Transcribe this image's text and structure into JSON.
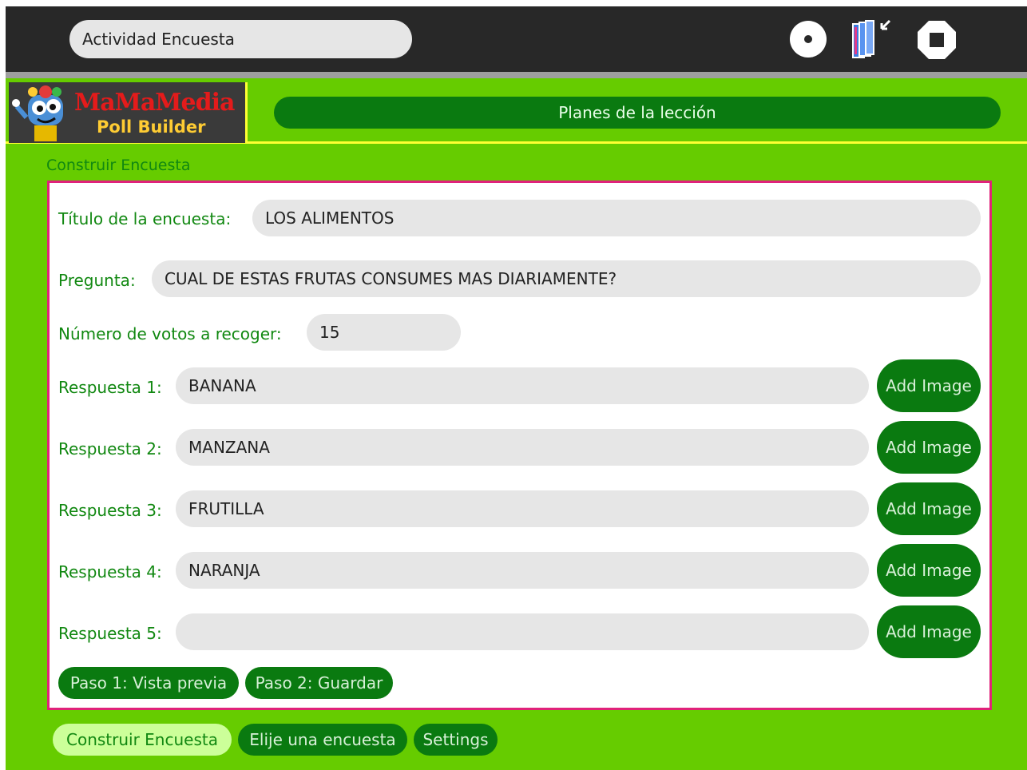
{
  "toolbar": {
    "activity_title": "Actividad Encuesta",
    "icons": [
      "share-icon",
      "keep-icon",
      "stop-icon"
    ]
  },
  "header": {
    "logo_title": "MaMaMedia",
    "logo_subtitle": "Poll Builder",
    "lesson_plans_label": "Planes de la lección"
  },
  "form": {
    "section_label": "Construir Encuesta",
    "title_label": "Título de la encuesta:",
    "title_value": "LOS ALIMENTOS",
    "question_label": "Pregunta:",
    "question_value": "CUAL DE ESTAS FRUTAS CONSUMES MAS DIARIAMENTE?",
    "votes_label": "Número de votos a recoger:",
    "votes_value": "15",
    "answers": [
      {
        "label": "Respuesta 1:",
        "value": "BANANA",
        "button": "Add Image"
      },
      {
        "label": "Respuesta 2:",
        "value": "MANZANA",
        "button": "Add Image"
      },
      {
        "label": "Respuesta 3:",
        "value": "FRUTILLA",
        "button": "Add Image"
      },
      {
        "label": "Respuesta 4:",
        "value": "NARANJA",
        "button": "Add Image"
      },
      {
        "label": "Respuesta 5:",
        "value": "",
        "button": "Add Image"
      }
    ],
    "step1_label": "Paso 1: Vista previa",
    "step2_label": "Paso 2: Guardar"
  },
  "tabs": [
    {
      "label": "Construir Encuesta",
      "active": true
    },
    {
      "label": "Elije una encuesta",
      "active": false
    },
    {
      "label": "Settings",
      "active": false
    }
  ],
  "colors": {
    "toolbar_bg": "#282828",
    "activity_bg": "#66cc00",
    "button_green": "#0a7a10",
    "panel_border": "#e0227a",
    "header_rule": "#ffff33",
    "active_tab": "#ccff99"
  }
}
